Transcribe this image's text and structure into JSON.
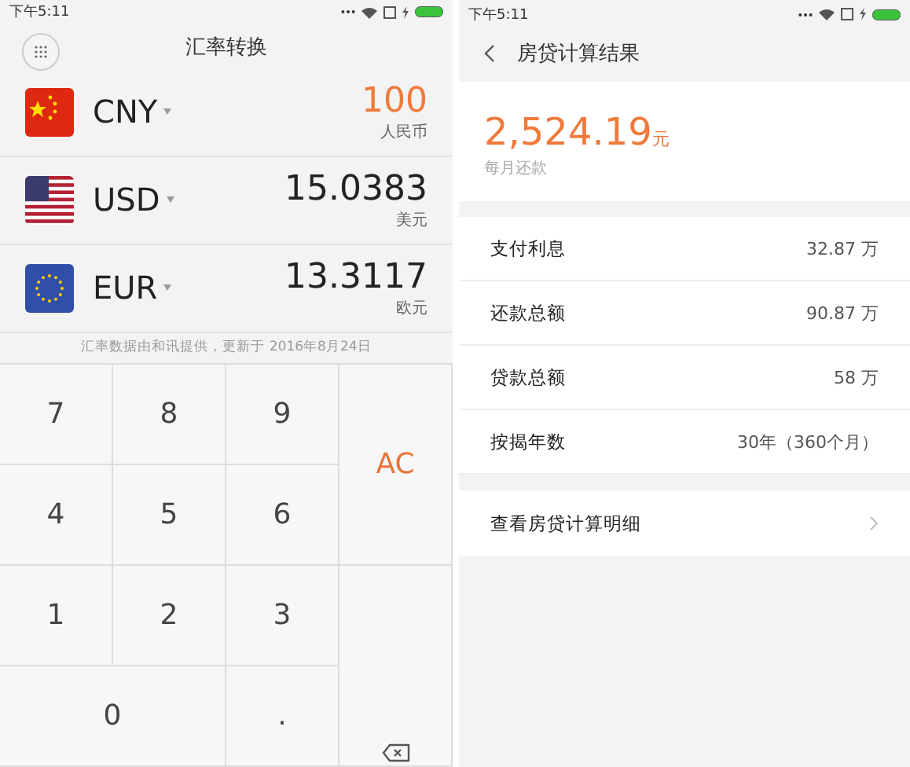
{
  "left_screen": {
    "status_bar": {
      "time": "下午5:11"
    },
    "title": "汇率转换",
    "currencies": [
      {
        "code": "CNY",
        "kind": "cn",
        "amount": "100",
        "name": "人民币",
        "selected": true
      },
      {
        "code": "USD",
        "kind": "us",
        "amount": "15.0383",
        "name": "美元",
        "selected": false
      },
      {
        "code": "EUR",
        "kind": "eu",
        "amount": "13.3117",
        "name": "欧元",
        "selected": false
      }
    ],
    "note": "汇率数据由和讯提供，更新于 2016年8月24日",
    "keypad": [
      {
        "label": "7",
        "kind": "digit"
      },
      {
        "label": "8",
        "kind": "digit"
      },
      {
        "label": "9",
        "kind": "digit"
      },
      {
        "label": "AC",
        "kind": "clear"
      },
      {
        "label": "4",
        "kind": "digit"
      },
      {
        "label": "5",
        "kind": "digit"
      },
      {
        "label": "6",
        "kind": "digit"
      },
      {
        "label": "1",
        "kind": "digit"
      },
      {
        "label": "2",
        "kind": "digit"
      },
      {
        "label": "3",
        "kind": "digit"
      },
      {
        "kind": "backspace"
      },
      {
        "label": "0",
        "kind": "zero"
      },
      {
        "label": ".",
        "kind": "digit"
      }
    ]
  },
  "right_screen": {
    "status_bar": {
      "time": "下午5:11"
    },
    "title": "房贷计算结果",
    "monthly": {
      "amount": "2,524.19",
      "unit": "元",
      "label": "每月还款"
    },
    "rows": [
      {
        "label": "支付利息",
        "value": "32.87 万"
      },
      {
        "label": "还款总额",
        "value": "90.87 万"
      },
      {
        "label": "贷款总额",
        "value": "58 万"
      },
      {
        "label": "按揭年数",
        "value": "30年（360个月）"
      }
    ],
    "detail_link": "查看房贷计算明细"
  }
}
